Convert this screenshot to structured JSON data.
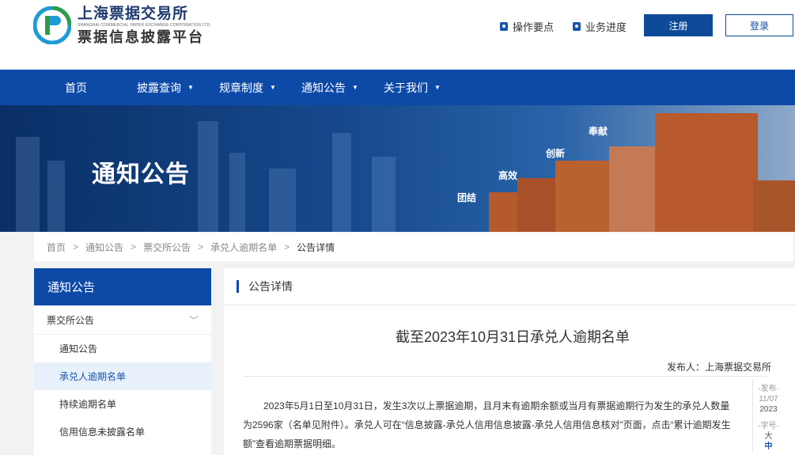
{
  "header": {
    "logo_cn": "上海票据交易所",
    "logo_en": "SHANGHAI COMMERCIAL PAPER EXCHANGE CORPORATION LTD.",
    "logo_sub": "票据信息披露平台",
    "links": [
      {
        "label": "操作要点",
        "icon": "document-icon"
      },
      {
        "label": "业务进度",
        "icon": "progress-icon"
      }
    ],
    "register_label": "注册",
    "login_label": "登录"
  },
  "nav": {
    "items": [
      "首页",
      "披露查询",
      "规章制度",
      "通知公告",
      "关于我们"
    ]
  },
  "banner": {
    "title": "通知公告",
    "words": [
      "团结",
      "高效",
      "创新",
      "奉献"
    ]
  },
  "breadcrumb": [
    "首页",
    "通知公告",
    "票交所公告",
    "承兑人逾期名单",
    "公告详情"
  ],
  "sidebar": {
    "heading": "通知公告",
    "category": "票交所公告",
    "items": [
      "通知公告",
      "承兑人逾期名单",
      "持续逾期名单",
      "信用信息未披露名单"
    ],
    "active_index": 1
  },
  "content": {
    "heading": "公告详情",
    "title": "截至2023年10月31日承兑人逾期名单",
    "publisher": "发布人：上海票据交易所",
    "body": "2023年5月1日至10月31日，发生3次以上票据逾期，且月末有逾期余额或当月有票据逾期行为发生的承兑人数量为2596家（名单见附件）。承兑人可在“信息披露-承兑人信用信息披露-承兑人信用信息核对”页面，点击“累计逾期发生额”查看逾期票据明细。",
    "side": {
      "publish_label": "-发布-",
      "date_md": "11/07",
      "year": "2023",
      "font_label": "-字号-",
      "font_big": "大",
      "font_mid": "中"
    }
  },
  "colors": {
    "primary": "#0d4aa8",
    "accent": "#1556a8",
    "building": "#b55a2a"
  }
}
